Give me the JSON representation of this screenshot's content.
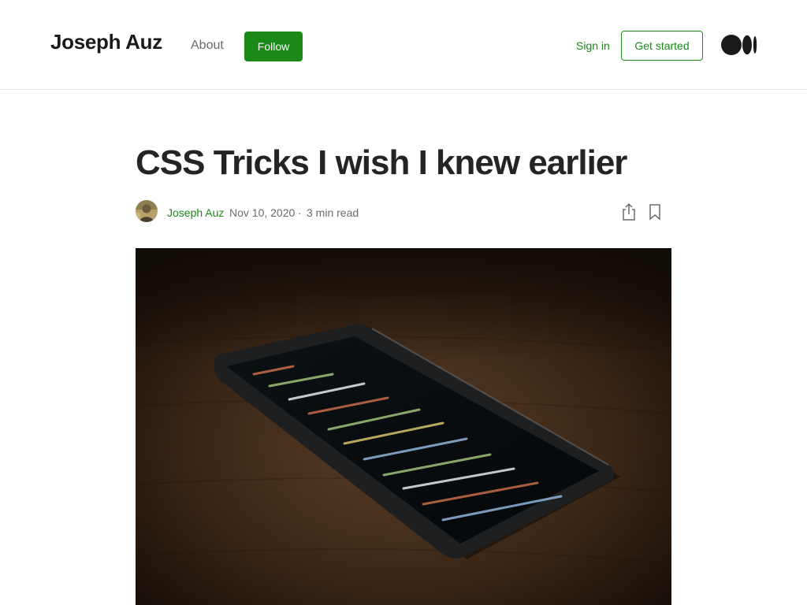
{
  "header": {
    "brand": "Joseph Auz",
    "about": "About",
    "follow": "Follow",
    "sign_in": "Sign in",
    "get_started": "Get started",
    "logo_icon": "medium-logo-icon"
  },
  "article": {
    "title": "CSS Tricks I wish I knew earlier",
    "author": "Joseph Auz",
    "date": "Nov 10, 2020",
    "separator": "·",
    "read_time": "3 min read",
    "hero_image": "smartphone-with-code-on-wooden-table"
  },
  "colors": {
    "accent": "#1a8917",
    "text": "#242424",
    "muted": "#6b6b6b",
    "divider": "#e6e6e6"
  }
}
